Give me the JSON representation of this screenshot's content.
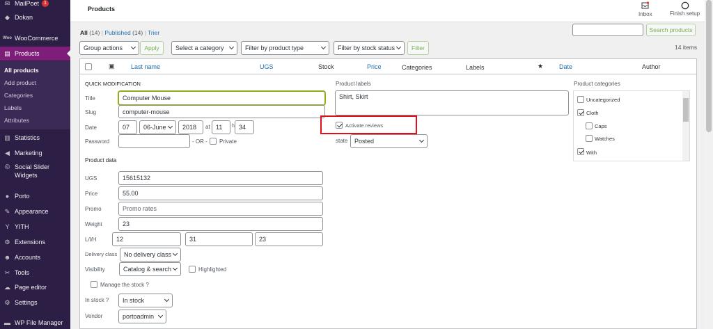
{
  "sidebar": {
    "top_items": [
      {
        "label": "MailPoet",
        "badge": "1"
      },
      {
        "label": "Dokan"
      },
      {
        "label": "WooCommerce"
      },
      {
        "label": "Products"
      }
    ],
    "sub_items": [
      "All products",
      "Add product",
      "Categories",
      "Labels",
      "Attributes"
    ],
    "bottom_items": [
      "Statistics",
      "Marketing",
      "Social Slider Widgets",
      "Porto",
      "Appearance",
      "YITH",
      "Extensions",
      "Accounts",
      "Tools",
      "Page editor",
      "Settings",
      "WP File Manager"
    ]
  },
  "topbar": {
    "title": "Products",
    "inbox": "Inbox",
    "setup": "Finish setup"
  },
  "views": {
    "all": "All",
    "all_count": "(14)",
    "sep1": "|",
    "published": "Published",
    "published_count": "(14)",
    "sep2": "|",
    "trash": "Trier"
  },
  "search": {
    "button": "Search products",
    "value": ""
  },
  "filters": {
    "bulk": "Group actions",
    "apply": "Apply",
    "category": "Select a category",
    "type": "Filter by product type",
    "stock": "Filter by stock status",
    "filter": "Filter",
    "count": "14 items"
  },
  "columns": {
    "thumb": "▣",
    "name": "Last name",
    "sku": "UGS",
    "stock": "Stock",
    "price": "Price",
    "categories": "Categories",
    "labels": "Labels",
    "featured": "★",
    "date": "Date",
    "author": "Author"
  },
  "quick": {
    "heading": "QUICK MODIFICATION",
    "title_label": "Title",
    "title_value": "Computer Mouse",
    "slug_label": "Slug",
    "slug_value": "computer-mouse",
    "date_label": "Date",
    "day": "07",
    "month": "06-June",
    "year": "2018",
    "at": "at",
    "hour": "11",
    "h": "h",
    "minute": "34",
    "password_label": "Password",
    "password_value": "",
    "or": "- OR -",
    "private": "Private",
    "product_data": "Product data",
    "sku_label": "UGS",
    "sku_value": "15615132",
    "price_label": "Price",
    "price_value": "55.00",
    "promo_label": "Promo",
    "promo_placeholder": "Promo rates",
    "weight_label": "Weight",
    "weight_value": "23",
    "dims_label": "L/l/H",
    "length": "12",
    "width": "31",
    "height": "23",
    "delivery_label": "Delivery class",
    "delivery_value": "No delivery class",
    "visibility_label": "Visibility",
    "visibility_value": "Catalog & search",
    "highlighted": "Highlighted",
    "manage_stock": "Manage the stock ?",
    "instock_label": "In stock ?",
    "instock_value": "In stock",
    "vendor_label": "Vendor",
    "vendor_value": "portoadmin",
    "labels_heading": "Product labels",
    "labels_value": "Shirt, Skirt",
    "activate_reviews": "Activate reviews",
    "state_label": "state",
    "state_value": "Posted",
    "cats_heading": "Product categories",
    "cats": [
      {
        "name": "Uncategorized",
        "checked": false,
        "indent": 0
      },
      {
        "name": "Cloth",
        "checked": true,
        "indent": 0
      },
      {
        "name": "Caps",
        "checked": false,
        "indent": 1
      },
      {
        "name": "Watches",
        "checked": false,
        "indent": 1
      },
      {
        "name": "With",
        "checked": true,
        "indent": 0
      }
    ]
  },
  "colors": {
    "highlight": "#e0101a",
    "accent": "#7d1f78"
  }
}
